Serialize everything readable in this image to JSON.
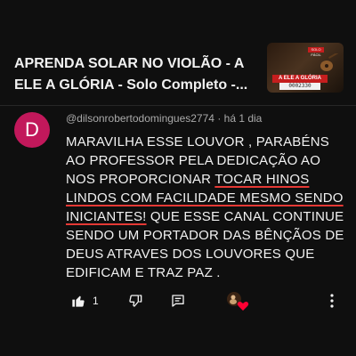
{
  "video": {
    "title": "APRENDA SOLAR NO VIOLÃO - A ELE A GLÓRIA  - Solo Completo -...",
    "thumbnail": {
      "badge": "SOLO FÁCIL",
      "banner": "A ELE A GLÓRIA",
      "code": "0002330"
    }
  },
  "comment": {
    "avatar_letter": "D",
    "author": "@dilsonrobertodomingues2774",
    "separator": "·",
    "time": "há 1 dia",
    "text_before": "MARAVILHA  ESSE LOUVOR , PARABÉNS  AO PROFESSOR PELA DEDICAÇÃO AO NOS PROPORCIONAR ",
    "text_underlined": "TOCAR HINOS LINDOS COM FACILIDADE MESMO SENDO INICIANTES!",
    "text_after": " QUE ESSE CANAL CONTINUE SENDO UM PORTADOR DAS BÊNÇÃOS  DE DEUS ATRAVES DOS LOUVORES QUE EDIFICAM E TRAZ PAZ .",
    "like_count": "1"
  },
  "colors": {
    "background": "#0f0f0f",
    "avatar": "#c2185b",
    "underline": "#e53935"
  },
  "icons": [
    "like-icon",
    "dislike-icon",
    "reply-icon",
    "creator-heart-icon",
    "more-options-icon"
  ]
}
